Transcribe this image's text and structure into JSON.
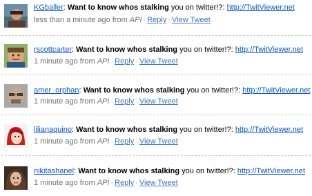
{
  "tweets": [
    {
      "username": "KGballer",
      "text_bold": "Want to know whos stalking",
      "text_rest": " you on twitter!?: ",
      "link": "http://TwitViewer.net",
      "time": "less than a minute ago from ",
      "source": "API",
      "reply": "Reply",
      "view": "View Tweet"
    },
    {
      "username": "rscottcarter",
      "text_bold": "Want to know whos stalking",
      "text_rest": " you on twitter!?: ",
      "link": "http://TwitViewer.net",
      "time": "1 minute ago from ",
      "source": "API",
      "reply": "Reply",
      "view": "View Tweet"
    },
    {
      "username": "amer_orphan",
      "text_bold": "Want to know whos stalking",
      "text_rest": " you on twitter!?: ",
      "link": "http://TwitViewer.net",
      "time": "1 minute ago from ",
      "source": "API",
      "reply": "Reply",
      "view": "View Tweet"
    },
    {
      "username": "lilianaquino",
      "text_bold": "Want to know whos stalking",
      "text_rest": " you on twitter!?: ",
      "link": "http://TwitViewer.net",
      "time": "1 minute ago from ",
      "source": "API",
      "reply": "Reply",
      "view": "View Tweet"
    },
    {
      "username": "nikitashanel",
      "text_bold": "Want to know whos stalking",
      "text_rest": " you on twitter!?: ",
      "link": "http://TwitViewer.net",
      "time": "1 minute ago from ",
      "source": "API",
      "reply": "Reply",
      "view": "View Tweet"
    }
  ],
  "separator_char": "·",
  "colors": {
    "link": "#0b55c4",
    "meta_link": "#3f74b8",
    "meta_text": "#6f6f6f",
    "separator": "#c8c8c8"
  }
}
